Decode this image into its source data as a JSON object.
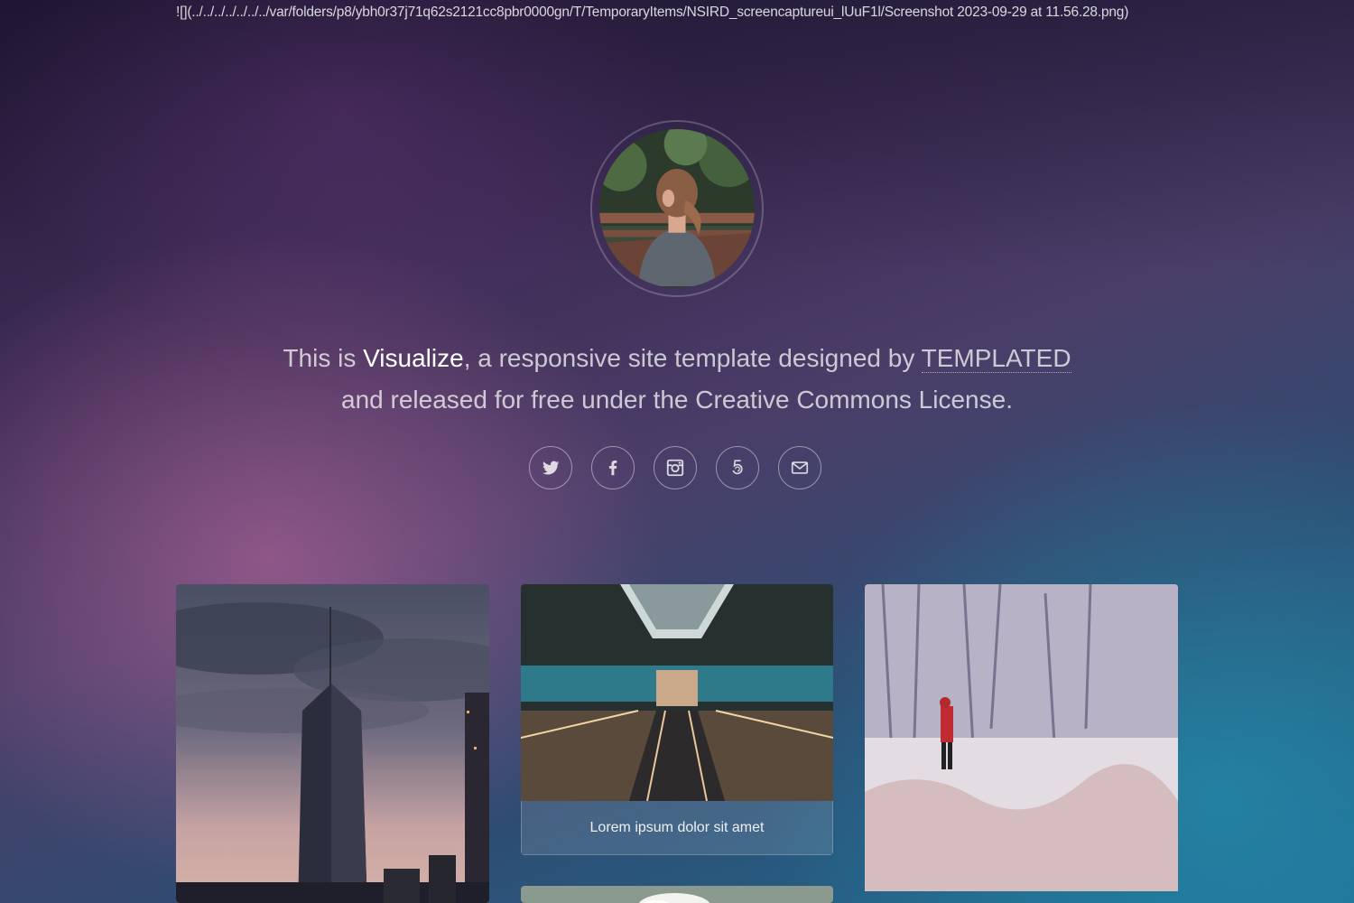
{
  "page": {
    "path_text": "![](../../../../../../../var/folders/p8/ybh0r37j71q62s2121cc8pbr0000gn/T/TemporaryItems/NSIRD_screencaptureui_lUuF1l/Screenshot 2023-09-29 at 11.56.28.png)"
  },
  "header": {
    "avatar_alt": "woman-on-bridge",
    "intro": {
      "prefix": "This is",
      "name": "Visualize",
      "middle": ", a responsive site template designed by",
      "link_label": "TEMPLATED",
      "line2": "and released for free under the Creative Commons License."
    },
    "social": [
      {
        "icon": "twitter-icon"
      },
      {
        "icon": "facebook-icon"
      },
      {
        "icon": "instagram-icon"
      },
      {
        "icon": "500px-icon"
      },
      {
        "icon": "envelope-icon"
      }
    ]
  },
  "gallery": {
    "items": [
      {
        "image": "city-skyline-tower",
        "caption": ""
      },
      {
        "image": "escalator-station",
        "caption": "Lorem ipsum dolor sit amet"
      },
      {
        "image": "person-in-snowy-forest",
        "caption": ""
      },
      {
        "image": "clouds-sky",
        "caption": ""
      }
    ]
  },
  "colors": {
    "accent_text": "#ffffff",
    "caption_bg": "rgba(255,255,255,0.12)"
  }
}
